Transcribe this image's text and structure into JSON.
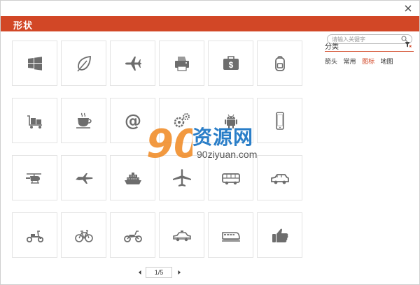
{
  "window": {
    "title": "形状"
  },
  "search": {
    "placeholder": "请输入关键字"
  },
  "categories": {
    "title": "分类",
    "items": [
      {
        "label": "箭头",
        "active": false
      },
      {
        "label": "常用",
        "active": false
      },
      {
        "label": "图标",
        "active": true
      },
      {
        "label": "地图",
        "active": false
      }
    ]
  },
  "icons": [
    "windows-icon",
    "leaf-icon",
    "airplane-icon",
    "printer-icon",
    "dollar-suitcase-icon",
    "backpack-icon",
    "luggage-cart-icon",
    "coffee-cup-icon",
    "at-sign-icon",
    "gears-icon",
    "android-icon",
    "smartphone-icon",
    "helicopter-icon",
    "jet-icon",
    "cruise-ship-icon",
    "airliner-icon",
    "bus-icon",
    "suv-icon",
    "scooter-icon",
    "bicycle-icon",
    "motorcycle-icon",
    "police-car-icon",
    "train-icon",
    "thumbs-up-icon"
  ],
  "pagination": {
    "label": "1/5",
    "current": 1,
    "total": 5
  },
  "watermark": {
    "logo": "90",
    "name": "资源网",
    "url": "90ziyuan.com"
  },
  "colors": {
    "accent": "#d24726",
    "icon": "#6d6d6d",
    "active_category": "#d24726",
    "watermark_blue": "#2a7ec8",
    "watermark_orange": "#f0871f"
  }
}
